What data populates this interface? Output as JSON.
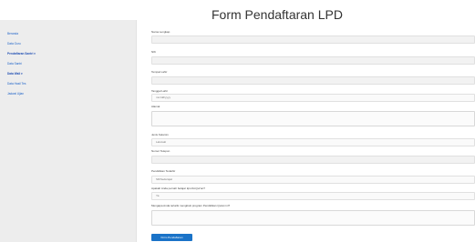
{
  "header": {
    "title": "Form Pendaftaran LPD"
  },
  "sidebar": {
    "items": [
      {
        "label": "Beranda"
      },
      {
        "label": "Data Guru"
      },
      {
        "label": "Pendaftaran Santri ▾"
      },
      {
        "label": "Data Santri"
      },
      {
        "label": "Data Wali ▾"
      },
      {
        "label": "Data Hasil Tes"
      },
      {
        "label": "Jadwal Ujian"
      }
    ]
  },
  "form": {
    "nama_label": "Nama Lengkap",
    "nik_label": "NIK",
    "tempat_lahir_label": "Tempat Lahir",
    "tanggal_lahir_label": "Tanggal Lahir",
    "tanggal_lahir_placeholder": "mm/dd/yyyy",
    "alamat_label": "Alamat",
    "jenis_kelamin_label": "Jenis Kelamin",
    "jenis_kelamin_value": "Laki-laki",
    "nomor_telepon_label": "Nomor Telepon",
    "pendidikan_label": "Pendidikan Terakhir",
    "pendidikan_value": "SD/Sederajat",
    "pertanyaan1_label": "Apakah Anda pernah belajar Iqro/Al-Qur'an?",
    "pertanyaan1_value": "Ya",
    "pertanyaan2_label": "Mengapa Anda tertarik mengikuti program Pendidikan Quran ini?",
    "submit_label": "Kirim Pendaftaran"
  }
}
